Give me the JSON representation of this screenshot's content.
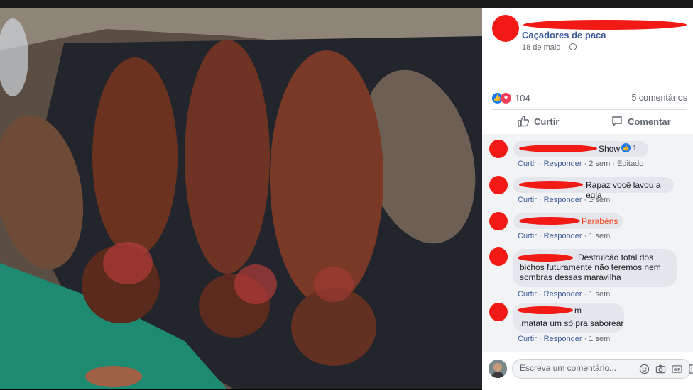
{
  "post": {
    "group_name": "Caçadores de paca",
    "date": "18 de maio",
    "reaction_count": "104",
    "comments_count": "5 comentários"
  },
  "actions": {
    "like": "Curtir",
    "comment": "Comentar"
  },
  "comments": [
    {
      "text": "Show",
      "reaction_count": "1",
      "meta_like": "Curtir",
      "meta_reply": "Responder",
      "meta_time": "2 sem",
      "meta_extra": "Editado"
    },
    {
      "text": "Rapaz você lavou a egla",
      "meta_like": "Curtir",
      "meta_reply": "Responder",
      "meta_time": "1 sem"
    },
    {
      "text": "Parabéns",
      "meta_like": "Curtir",
      "meta_reply": "Responder",
      "meta_time": "1 sem"
    },
    {
      "text": "Destruicão total dos bichos futuramente não teremos nem sombras dessas maravilha",
      "meta_like": "Curtir",
      "meta_reply": "Responder",
      "meta_time": "1 sem"
    },
    {
      "text_line1": "m",
      "text_line2": ".matata um só pra saborear",
      "meta_like": "Curtir",
      "meta_reply": "Responder",
      "meta_time": "1 sem"
    }
  ],
  "composer": {
    "placeholder": "Escreva um comentário..."
  },
  "colors": {
    "link": "#385898",
    "redaction": "#f21a14",
    "like_blue": "#1877f2",
    "love_red": "#f33e58"
  },
  "icons": [
    "globe-icon",
    "like-reaction-icon",
    "love-reaction-icon",
    "thumbs-up-icon",
    "comment-icon",
    "emoji-icon",
    "camera-icon",
    "gif-icon",
    "sticker-icon"
  ]
}
